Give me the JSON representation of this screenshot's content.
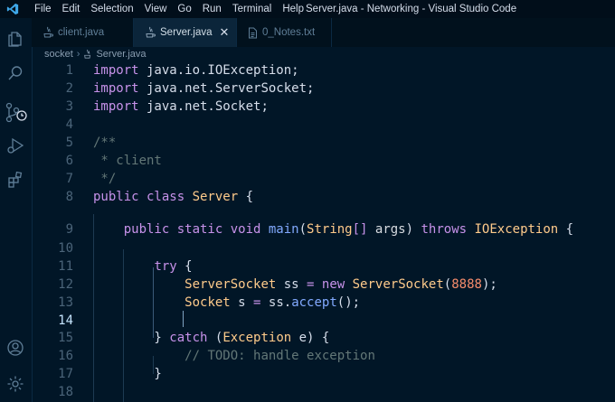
{
  "window": {
    "title": "Server.java - Networking - Visual Studio Code"
  },
  "menu": [
    "File",
    "Edit",
    "Selection",
    "View",
    "Go",
    "Run",
    "Terminal",
    "Help"
  ],
  "tabs": [
    {
      "label": "client.java",
      "icon": "java-file-icon",
      "active": false
    },
    {
      "label": "Server.java",
      "icon": "java-file-icon",
      "active": true,
      "close": "✕"
    },
    {
      "label": "0_Notes.txt",
      "icon": "text-file-icon",
      "active": false
    }
  ],
  "breadcrumb": {
    "folder": "socket",
    "separator": "›",
    "file": "Server.java"
  },
  "editor": {
    "lines": [
      {
        "n": "1",
        "tokens": [
          [
            "kw",
            "import"
          ],
          [
            "df",
            " java.io.IOException;"
          ]
        ]
      },
      {
        "n": "2",
        "tokens": [
          [
            "kw",
            "import"
          ],
          [
            "df",
            " java.net.ServerSocket;"
          ]
        ]
      },
      {
        "n": "3",
        "tokens": [
          [
            "kw",
            "import"
          ],
          [
            "df",
            " java.net.Socket;"
          ]
        ]
      },
      {
        "n": "4",
        "tokens": []
      },
      {
        "n": "5",
        "tokens": [
          [
            "cm",
            "/**"
          ]
        ]
      },
      {
        "n": "6",
        "tokens": [
          [
            "cm",
            " * client"
          ]
        ]
      },
      {
        "n": "7",
        "tokens": [
          [
            "cm",
            " */"
          ]
        ]
      },
      {
        "n": "8",
        "tokens": [
          [
            "kw",
            "public class "
          ],
          [
            "ty",
            "Server"
          ],
          [
            "df",
            " {"
          ]
        ]
      },
      {
        "n": "9",
        "tokens": [
          [
            "df",
            "    "
          ],
          [
            "kw",
            "public static void "
          ],
          [
            "fn",
            "main"
          ],
          [
            "df",
            "("
          ],
          [
            "ty",
            "String"
          ],
          [
            "kw",
            "[]"
          ],
          [
            "pm",
            " args"
          ],
          [
            "df",
            ") "
          ],
          [
            "kw",
            "throws "
          ],
          [
            "ty",
            "IOException"
          ],
          [
            "df",
            " {"
          ]
        ]
      },
      {
        "n": "10",
        "tokens": []
      },
      {
        "n": "11",
        "tokens": [
          [
            "df",
            "        "
          ],
          [
            "kw",
            "try "
          ],
          [
            "df",
            "{"
          ]
        ]
      },
      {
        "n": "12",
        "tokens": [
          [
            "df",
            "            "
          ],
          [
            "ty",
            "ServerSocket"
          ],
          [
            "df",
            " ss "
          ],
          [
            "op",
            "="
          ],
          [
            "kw",
            " new "
          ],
          [
            "ty",
            "ServerSocket"
          ],
          [
            "df",
            "("
          ],
          [
            "nm",
            "8888"
          ],
          [
            "df",
            ");"
          ]
        ]
      },
      {
        "n": "13",
        "tokens": [
          [
            "df",
            "            "
          ],
          [
            "ty",
            "Socket"
          ],
          [
            "df",
            " s "
          ],
          [
            "op",
            "="
          ],
          [
            "df",
            " ss."
          ],
          [
            "fn",
            "accept"
          ],
          [
            "df",
            "();"
          ]
        ]
      },
      {
        "n": "14",
        "tokens": []
      },
      {
        "n": "15",
        "tokens": [
          [
            "df",
            "        } "
          ],
          [
            "kw",
            "catch"
          ],
          [
            "df",
            " ("
          ],
          [
            "ty",
            "Exception"
          ],
          [
            "df",
            " e) {"
          ]
        ]
      },
      {
        "n": "16",
        "tokens": [
          [
            "df",
            "            "
          ],
          [
            "cm",
            "// TODO: handle exception"
          ]
        ]
      },
      {
        "n": "17",
        "tokens": [
          [
            "df",
            "        }"
          ]
        ]
      },
      {
        "n": "18",
        "tokens": []
      }
    ],
    "current_line": "14"
  },
  "activity": [
    "explorer-icon",
    "search-icon",
    "source-control-icon",
    "run-debug-icon",
    "extensions-icon",
    "account-icon",
    "settings-gear-icon"
  ]
}
